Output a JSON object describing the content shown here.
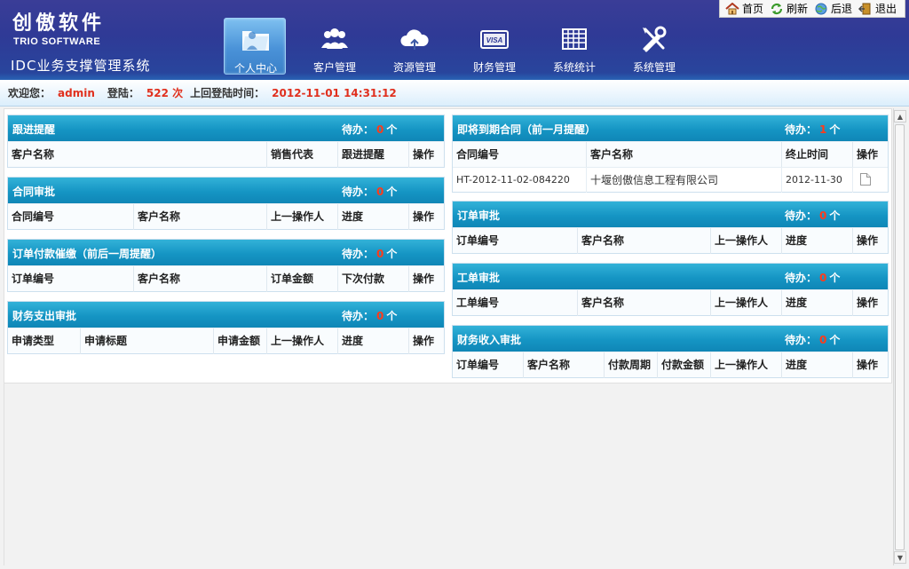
{
  "brand": {
    "name_cn": "创傲软件",
    "name_en": "TRIO SOFTWARE",
    "system": "IDC业务支撑管理系统"
  },
  "nav": [
    {
      "label": "个人中心",
      "icon": "folder-icon",
      "active": true
    },
    {
      "label": "客户管理",
      "icon": "users-icon",
      "active": false
    },
    {
      "label": "资源管理",
      "icon": "cloud-upload-icon",
      "active": false
    },
    {
      "label": "财务管理",
      "icon": "visa-card-icon",
      "active": false
    },
    {
      "label": "系统统计",
      "icon": "grid-table-icon",
      "active": false
    },
    {
      "label": "系统管理",
      "icon": "tools-icon",
      "active": false
    }
  ],
  "toplinks": {
    "home": "首页",
    "refresh": "刷新",
    "back": "后退",
    "exit": "退出"
  },
  "welcome": {
    "greeting": "欢迎您：",
    "user": "admin",
    "login_label": "登陆：",
    "login_count": "522 次",
    "last_login_label": "上回登陆时间：",
    "last_login_time": "2012-11-01 14:31:12"
  },
  "pending_label": "待办：",
  "pending_unit": "个",
  "panels": {
    "followup": {
      "title": "跟进提醒",
      "count": "0",
      "columns": [
        "客户名称",
        "销售代表",
        "跟进提醒",
        "操作"
      ]
    },
    "contract_approval": {
      "title": "合同审批",
      "count": "0",
      "columns": [
        "合同编号",
        "客户名称",
        "上一操作人",
        "进度",
        "操作"
      ]
    },
    "order_payment": {
      "title": "订单付款催缴（前后一周提醒）",
      "count": "0",
      "columns": [
        "订单编号",
        "客户名称",
        "订单金额",
        "下次付款",
        "操作"
      ]
    },
    "expense_approval": {
      "title": "财务支出审批",
      "count": "0",
      "columns": [
        "申请类型",
        "申请标题",
        "申请金额",
        "上一操作人",
        "进度",
        "操作"
      ]
    },
    "expiring_contracts": {
      "title": "即将到期合同（前一月提醒）",
      "count": "1",
      "columns": [
        "合同编号",
        "客户名称",
        "终止时间",
        "操作"
      ],
      "rows": [
        {
          "code": "HT-2012-11-02-084220",
          "customer": "十堰创傲信息工程有限公司",
          "end": "2012-11-30",
          "action_icon": "document-icon"
        }
      ]
    },
    "order_approval": {
      "title": "订单审批",
      "count": "0",
      "columns": [
        "订单编号",
        "客户名称",
        "上一操作人",
        "进度",
        "操作"
      ]
    },
    "workorder_approval": {
      "title": "工单审批",
      "count": "0",
      "columns": [
        "工单编号",
        "客户名称",
        "上一操作人",
        "进度",
        "操作"
      ]
    },
    "income_approval": {
      "title": "财务收入审批",
      "count": "0",
      "columns": [
        "订单编号",
        "客户名称",
        "付款周期",
        "付款金额",
        "上一操作人",
        "进度",
        "操作"
      ]
    }
  }
}
